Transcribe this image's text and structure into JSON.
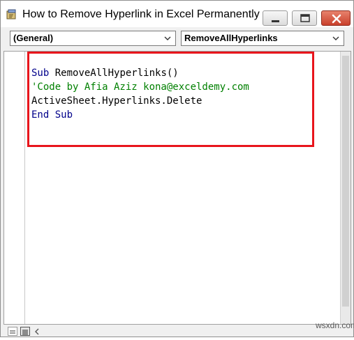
{
  "window": {
    "title": "How to Remove Hyperlink in Excel Permanently.xl...",
    "app_icon": "vba-editor-icon",
    "controls": [
      "minimize-icon",
      "maximize-icon",
      "close-icon"
    ]
  },
  "toolbar": {
    "object_combo": "(General)",
    "procedure_combo": "RemoveAllHyperlinks"
  },
  "code": {
    "line1_keyword": "Sub",
    "line1_name": " RemoveAllHyperlinks()",
    "line2_comment": "'Code by Afia Aziz kona@exceldemy.com",
    "line3_statement": "ActiveSheet.Hyperlinks.Delete",
    "line4_keyword": "End Sub"
  },
  "colors": {
    "keyword": "#00008b",
    "comment": "#008000",
    "highlight_border": "#e8151c",
    "close_button": "#c9402b"
  },
  "watermark": "wsxdn.com"
}
